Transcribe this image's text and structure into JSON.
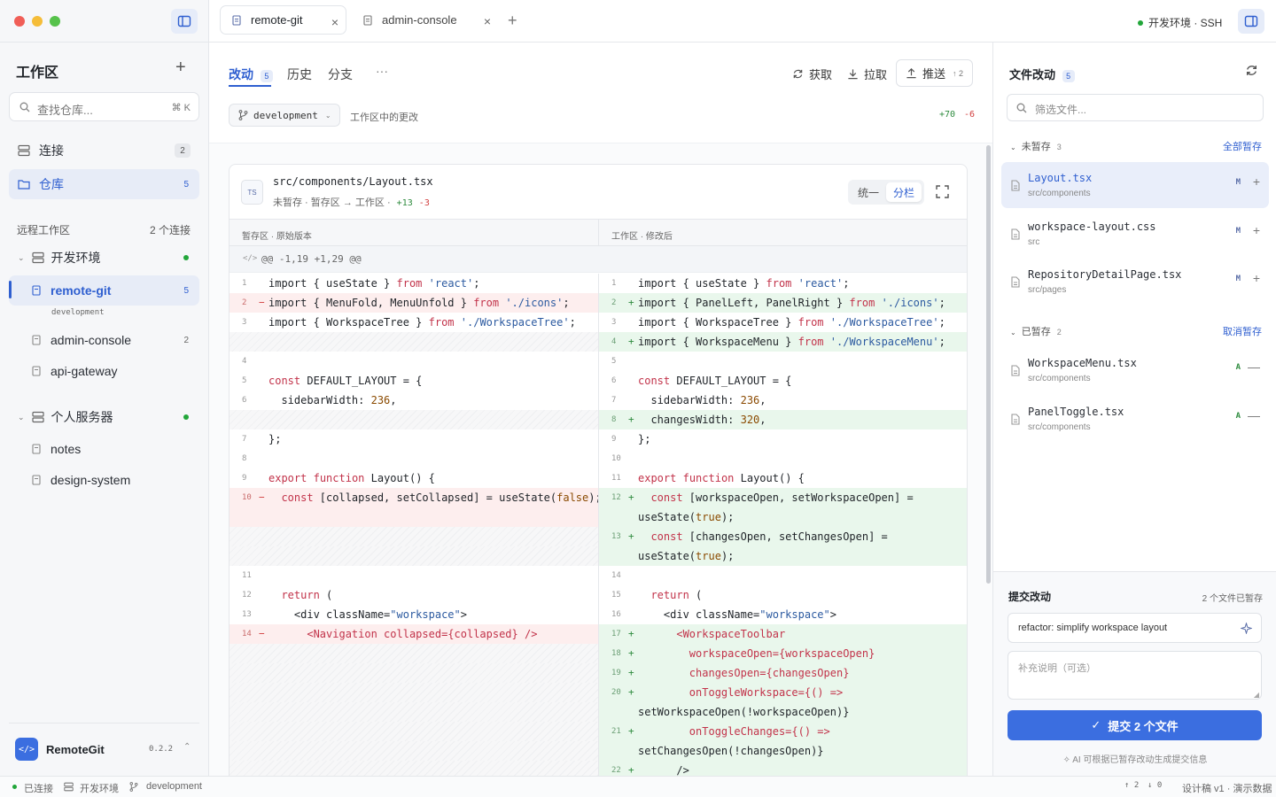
{
  "window": {
    "tabs": [
      {
        "label": "remote-git",
        "active": true
      },
      {
        "label": "admin-console",
        "active": false
      }
    ],
    "env_label": "开发环境 · SSH"
  },
  "sidebar": {
    "title": "工作区",
    "search_placeholder": "查找仓库...",
    "search_shortcut": "⌘ K",
    "nav": [
      {
        "label": "连接",
        "count": "2"
      },
      {
        "label": "仓库",
        "count": "5"
      }
    ],
    "remote_section": {
      "label": "远程工作区",
      "count": "2 个连接"
    },
    "groups": [
      {
        "label": "开发环境",
        "repos": [
          {
            "label": "remote-git",
            "count": "5",
            "branch": "development"
          },
          {
            "label": "admin-console",
            "count": "2"
          },
          {
            "label": "api-gateway"
          }
        ]
      },
      {
        "label": "个人服务器",
        "repos": [
          {
            "label": "notes"
          },
          {
            "label": "design-system"
          }
        ]
      }
    ],
    "app": {
      "name": "RemoteGit",
      "version": "0.2.2"
    }
  },
  "main": {
    "tabs": [
      {
        "label": "改动",
        "count": "5"
      },
      {
        "label": "历史"
      },
      {
        "label": "分支"
      }
    ],
    "more": "···",
    "actions": {
      "fetch": "获取",
      "pull": "拉取",
      "push": "推送",
      "push_count": "↑ 2"
    },
    "branch": "development",
    "branch_desc": "工作区中的更改",
    "added_total": "+70",
    "removed_total": "-6",
    "file": {
      "badge": "TS",
      "path": "src/components/Layout.tsx",
      "meta": "未暂存 · 暂存区 → 工作区 ·",
      "added": "+13",
      "removed": "-3",
      "view_unified": "统一",
      "view_split": "分栏"
    },
    "left_header": "暂存区 · 原始版本",
    "right_header": "工作区 · 修改后",
    "hunk": "@@ -1,19 +1,29 @@"
  },
  "diff": {
    "left": [
      {
        "n": "1",
        "t": "",
        "c": [
          [
            "import { useState } ",
            ""
          ],
          [
            "from",
            "kw"
          ],
          [
            " ",
            ""
          ],
          [
            "'react'",
            "str"
          ],
          [
            ";",
            ""
          ]
        ]
      },
      {
        "n": "2",
        "t": "del",
        "c": [
          [
            "import { MenuFold, MenuUnfold } ",
            ""
          ],
          [
            "from",
            "kw"
          ],
          [
            " ",
            ""
          ],
          [
            "'./icons'",
            "str"
          ],
          [
            ";",
            ""
          ]
        ]
      },
      {
        "n": "3",
        "t": "",
        "c": [
          [
            "import { WorkspaceTree } ",
            ""
          ],
          [
            "from",
            "kw"
          ],
          [
            " ",
            ""
          ],
          [
            "'./WorkspaceTree'",
            "str"
          ],
          [
            ";",
            ""
          ]
        ]
      },
      {
        "n": "",
        "t": "hatch",
        "c": []
      },
      {
        "n": "4",
        "t": "",
        "c": []
      },
      {
        "n": "5",
        "t": "",
        "c": [
          [
            "const",
            "kw"
          ],
          [
            " DEFAULT_LAYOUT = {",
            ""
          ]
        ]
      },
      {
        "n": "6",
        "t": "",
        "c": [
          [
            "  sidebarWidth: ",
            ""
          ],
          [
            "236",
            "num"
          ],
          [
            ",",
            ""
          ]
        ]
      },
      {
        "n": "",
        "t": "hatch",
        "c": []
      },
      {
        "n": "7",
        "t": "",
        "c": [
          [
            "};",
            ""
          ]
        ]
      },
      {
        "n": "8",
        "t": "",
        "c": []
      },
      {
        "n": "9",
        "t": "",
        "c": [
          [
            "export",
            "kw"
          ],
          [
            " ",
            ""
          ],
          [
            "function",
            "kw"
          ],
          [
            " Layout() {",
            ""
          ]
        ]
      },
      {
        "n": "10",
        "t": "del",
        "c": [
          [
            "  ",
            ""
          ],
          [
            "const",
            "kw"
          ],
          [
            " [collapsed, setCollapsed] = useState(",
            ""
          ],
          [
            "false",
            "num"
          ],
          [
            ");",
            ""
          ]
        ]
      },
      {
        "n": "",
        "t": "del",
        "c": []
      },
      {
        "n": "",
        "t": "hatch",
        "c": []
      },
      {
        "n": "",
        "t": "hatch",
        "c": []
      },
      {
        "n": "11",
        "t": "",
        "c": []
      },
      {
        "n": "12",
        "t": "",
        "c": [
          [
            "  ",
            ""
          ],
          [
            "return",
            "kw"
          ],
          [
            " (",
            ""
          ]
        ]
      },
      {
        "n": "13",
        "t": "",
        "c": [
          [
            "    <div className=",
            ""
          ],
          [
            "\"workspace\"",
            "str"
          ],
          [
            ">",
            ""
          ]
        ]
      },
      {
        "n": "14",
        "t": "del",
        "c": [
          [
            "      <Navigation collapsed={collapsed} />",
            "kw"
          ]
        ]
      },
      {
        "n": "",
        "t": "hatch",
        "c": []
      },
      {
        "n": "",
        "t": "hatch",
        "c": []
      },
      {
        "n": "",
        "t": "hatch",
        "c": []
      },
      {
        "n": "",
        "t": "hatch",
        "c": []
      },
      {
        "n": "",
        "t": "hatch",
        "c": []
      },
      {
        "n": "",
        "t": "hatch",
        "c": []
      },
      {
        "n": "",
        "t": "hatch",
        "c": []
      },
      {
        "n": "",
        "t": "hatch",
        "c": []
      }
    ],
    "right": [
      {
        "n": "1",
        "t": "",
        "c": [
          [
            "import { useState } ",
            ""
          ],
          [
            "from",
            "kw"
          ],
          [
            " ",
            ""
          ],
          [
            "'react'",
            "str"
          ],
          [
            ";",
            ""
          ]
        ]
      },
      {
        "n": "2",
        "t": "add",
        "c": [
          [
            "import { PanelLeft, PanelRight } ",
            ""
          ],
          [
            "from",
            "kw"
          ],
          [
            " ",
            ""
          ],
          [
            "'./icons'",
            "str"
          ],
          [
            ";",
            ""
          ]
        ]
      },
      {
        "n": "3",
        "t": "",
        "c": [
          [
            "import { WorkspaceTree } ",
            ""
          ],
          [
            "from",
            "kw"
          ],
          [
            " ",
            ""
          ],
          [
            "'./WorkspaceTree'",
            "str"
          ],
          [
            ";",
            ""
          ]
        ]
      },
      {
        "n": "4",
        "t": "add",
        "c": [
          [
            "import { WorkspaceMenu } ",
            ""
          ],
          [
            "from",
            "kw"
          ],
          [
            " ",
            ""
          ],
          [
            "'./WorkspaceMenu'",
            "str"
          ],
          [
            ";",
            ""
          ]
        ]
      },
      {
        "n": "5",
        "t": "",
        "c": []
      },
      {
        "n": "6",
        "t": "",
        "c": [
          [
            "const",
            "kw"
          ],
          [
            " DEFAULT_LAYOUT = {",
            ""
          ]
        ]
      },
      {
        "n": "7",
        "t": "",
        "c": [
          [
            "  sidebarWidth: ",
            ""
          ],
          [
            "236",
            "num"
          ],
          [
            ",",
            ""
          ]
        ]
      },
      {
        "n": "8",
        "t": "add",
        "c": [
          [
            "  changesWidth: ",
            ""
          ],
          [
            "320",
            "num"
          ],
          [
            ",",
            ""
          ]
        ]
      },
      {
        "n": "9",
        "t": "",
        "c": [
          [
            "};",
            ""
          ]
        ]
      },
      {
        "n": "10",
        "t": "",
        "c": []
      },
      {
        "n": "11",
        "t": "",
        "c": [
          [
            "export",
            "kw"
          ],
          [
            " ",
            ""
          ],
          [
            "function",
            "kw"
          ],
          [
            " Layout() {",
            ""
          ]
        ]
      },
      {
        "n": "12",
        "t": "add",
        "c": [
          [
            "  ",
            ""
          ],
          [
            "const",
            "kw"
          ],
          [
            " [workspaceOpen, setWorkspaceOpen] =",
            ""
          ]
        ]
      },
      {
        "n": "",
        "t": "add",
        "c": [
          [
            "useState(",
            ""
          ],
          [
            "true",
            "num"
          ],
          [
            ");",
            ""
          ]
        ]
      },
      {
        "n": "13",
        "t": "add",
        "c": [
          [
            "  ",
            ""
          ],
          [
            "const",
            "kw"
          ],
          [
            " [changesOpen, setChangesOpen] =",
            ""
          ]
        ]
      },
      {
        "n": "",
        "t": "add",
        "c": [
          [
            "useState(",
            ""
          ],
          [
            "true",
            "num"
          ],
          [
            ");",
            ""
          ]
        ]
      },
      {
        "n": "14",
        "t": "",
        "c": []
      },
      {
        "n": "15",
        "t": "",
        "c": [
          [
            "  ",
            ""
          ],
          [
            "return",
            "kw"
          ],
          [
            " (",
            ""
          ]
        ]
      },
      {
        "n": "16",
        "t": "",
        "c": [
          [
            "    <div className=",
            ""
          ],
          [
            "\"workspace\"",
            "str"
          ],
          [
            ">",
            ""
          ]
        ]
      },
      {
        "n": "17",
        "t": "add",
        "c": [
          [
            "      <WorkspaceToolbar",
            "kw"
          ]
        ]
      },
      {
        "n": "18",
        "t": "add",
        "c": [
          [
            "        workspaceOpen={workspaceOpen}",
            "kw"
          ]
        ]
      },
      {
        "n": "19",
        "t": "add",
        "c": [
          [
            "        changesOpen={changesOpen}",
            "kw"
          ]
        ]
      },
      {
        "n": "20",
        "t": "add",
        "c": [
          [
            "        onToggleWorkspace={() =>",
            "kw"
          ]
        ]
      },
      {
        "n": "",
        "t": "add",
        "c": [
          [
            "setWorkspaceOpen(!workspaceOpen)}",
            ""
          ]
        ]
      },
      {
        "n": "21",
        "t": "add",
        "c": [
          [
            "        onToggleChanges={() =>",
            "kw"
          ]
        ]
      },
      {
        "n": "",
        "t": "add",
        "c": [
          [
            "setChangesOpen(!changesOpen)}",
            ""
          ]
        ]
      },
      {
        "n": "22",
        "t": "add",
        "c": [
          [
            "      />",
            ""
          ]
        ]
      }
    ]
  },
  "changes": {
    "title": "文件改动",
    "count": "5",
    "filter_placeholder": "筛选文件...",
    "unstaged": {
      "label": "未暂存",
      "count": "3",
      "action": "全部暂存",
      "files": [
        {
          "name": "Layout.tsx",
          "path": "src/components",
          "status": "M",
          "action": "+"
        },
        {
          "name": "workspace-layout.css",
          "path": "src",
          "status": "M",
          "action": "+"
        },
        {
          "name": "RepositoryDetailPage.tsx",
          "path": "src/pages",
          "status": "M",
          "action": "+"
        }
      ]
    },
    "staged": {
      "label": "已暂存",
      "count": "2",
      "action": "取消暂存",
      "files": [
        {
          "name": "WorkspaceMenu.tsx",
          "path": "src/components",
          "status": "A",
          "action": "—"
        },
        {
          "name": "PanelToggle.tsx",
          "path": "src/components",
          "status": "A",
          "action": "—"
        }
      ]
    },
    "commit": {
      "title": "提交改动",
      "staged_info": "2 个文件已暂存",
      "message": "refactor: simplify workspace layout",
      "desc_placeholder": "补充说明（可选）",
      "button": "提交 2 个文件",
      "ai_hint": "AI 可根据已暂存改动生成提交信息"
    }
  },
  "status": {
    "connected": "已连接",
    "env": "开发环境",
    "branch": "development",
    "ahead": "↑ 2",
    "behind": "↓ 0",
    "info": "设计稿 v1 · 演示数据"
  },
  "colors": {
    "accent": "#2f5fd0",
    "add": "#2e8b3e",
    "del": "#d24040",
    "ok": "#22a63a"
  }
}
